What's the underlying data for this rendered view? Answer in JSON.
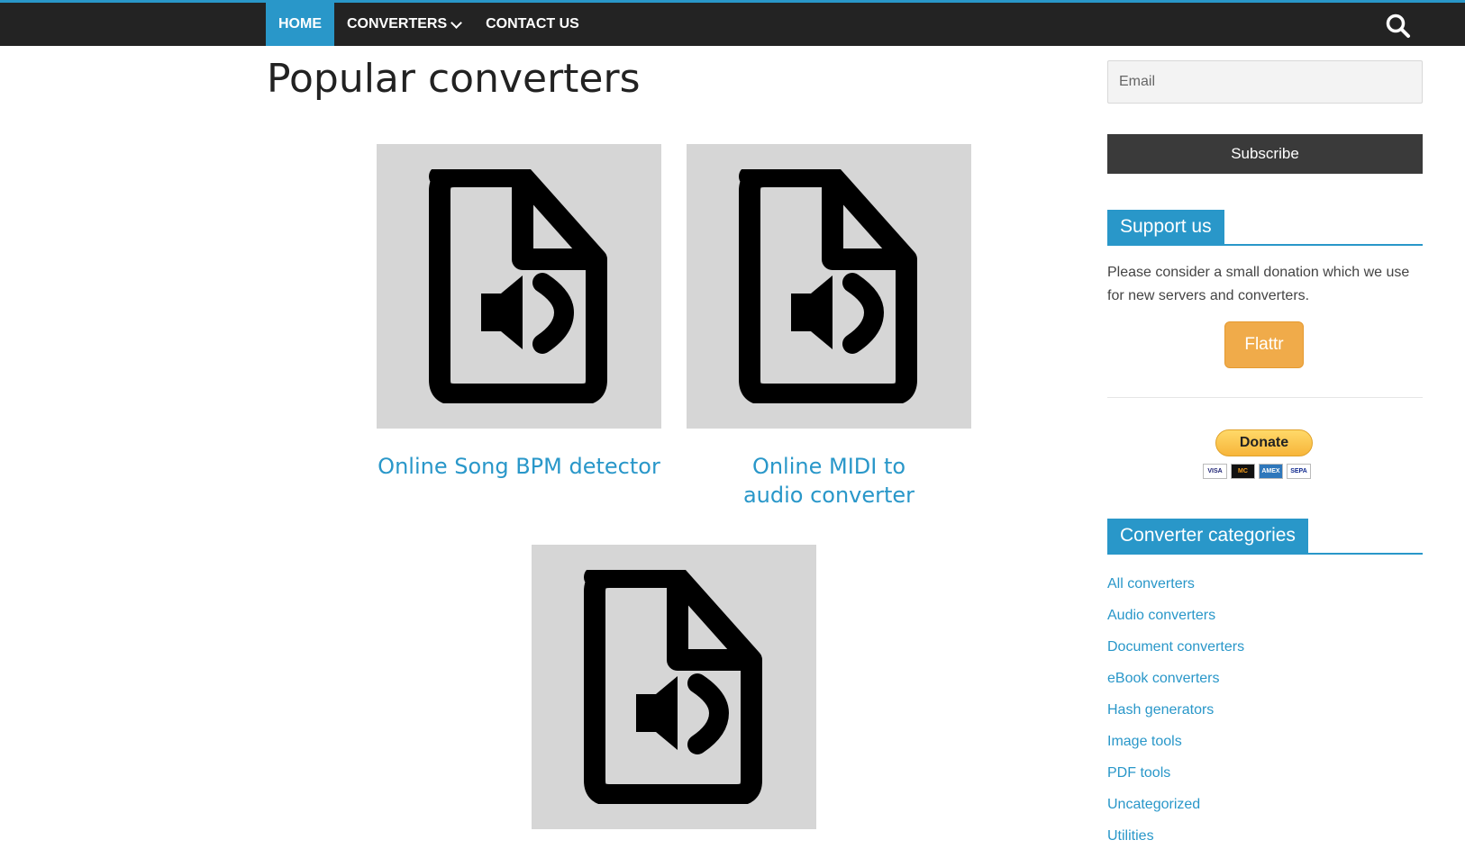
{
  "nav": {
    "items": [
      {
        "label": "HOME"
      },
      {
        "label": "CONVERTERS"
      },
      {
        "label": "CONTACT US"
      }
    ]
  },
  "main": {
    "title": "Popular converters",
    "cards": [
      {
        "title": "Online Song BPM detector",
        "icon": "audio-file-icon"
      },
      {
        "title": "Online MIDI to audio converter",
        "icon": "audio-file-icon"
      },
      {
        "title": "",
        "icon": "audio-file-icon"
      }
    ]
  },
  "sidebar": {
    "email_placeholder": "Email",
    "subscribe_label": "Subscribe",
    "support_heading": "Support us",
    "support_text": "Please consider a small donation which we use for new servers and converters.",
    "flattr_label": "Flattr",
    "donate_label": "Donate",
    "payment_cards": [
      "VISA",
      "MC",
      "AMEX",
      "SEPA"
    ],
    "categories_heading": "Converter categories",
    "categories": [
      "All converters",
      "Audio converters",
      "Document converters",
      "eBook converters",
      "Hash generators",
      "Image tools",
      "PDF tools",
      "Uncategorized",
      "Utilities"
    ]
  },
  "colors": {
    "accent": "#2997c9",
    "nav_bg": "#232323",
    "flattr": "#f0ab4a"
  }
}
